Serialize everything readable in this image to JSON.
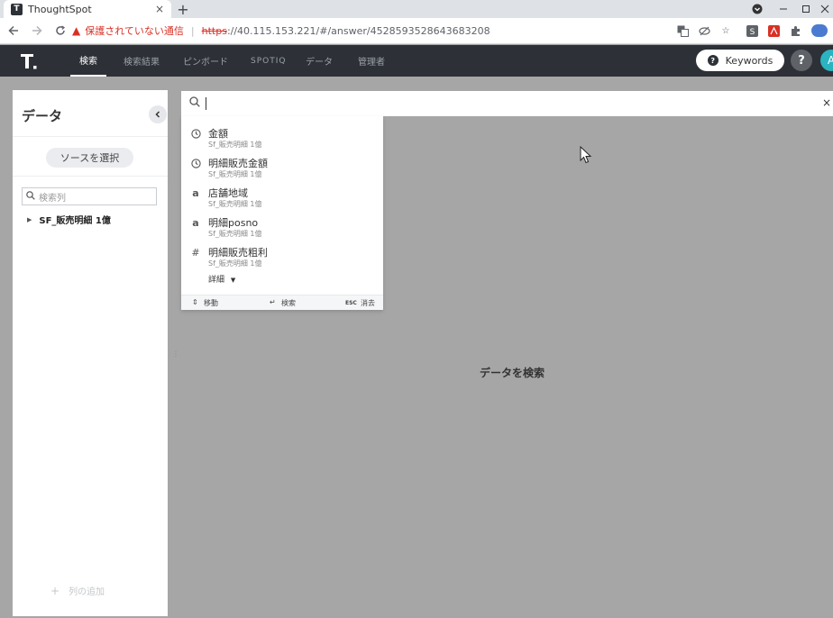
{
  "browser": {
    "tab_title": "ThoughtSpot",
    "tab_close": "×",
    "new_tab": "+",
    "security_warning": "保護されていない通信",
    "url_scheme": "https",
    "url_rest": "://40.115.153.221/#/answer/4528593528643683208"
  },
  "app_nav": {
    "items": [
      "検索",
      "検索結果",
      "ピンボード",
      "SPOTIQ",
      "データ",
      "管理者"
    ],
    "active": "検索",
    "keywords_label": "Keywords",
    "help_label": "?",
    "avatar_initial": "A"
  },
  "data_panel": {
    "title": "データ",
    "select_source": "ソースを選択",
    "search_placeholder": "検索列",
    "source_name": "SF_販売明細 1億",
    "add_column": "列の追加"
  },
  "search": {
    "suggestions": [
      {
        "icon": "clock-icon",
        "name": "金額",
        "source": "Sf_販売明細 1億"
      },
      {
        "icon": "clock-icon",
        "name": "明細販売金額",
        "source": "Sf_販売明細 1億"
      },
      {
        "icon": "text-attribute-icon",
        "name": "店舗地域",
        "source": "Sf_販売明細 1億"
      },
      {
        "icon": "text-attribute-icon",
        "name": "明細posno",
        "source": "Sf_販売明細 1億"
      },
      {
        "icon": "measure-icon",
        "name": "明細販売粗利",
        "source": "Sf_販売明細 1億"
      }
    ],
    "more_label": "詳細",
    "footer": {
      "move": "移動",
      "search": "検索",
      "esc": "ESC",
      "clear": "消去"
    }
  },
  "main": {
    "empty_message": "データを検索"
  }
}
